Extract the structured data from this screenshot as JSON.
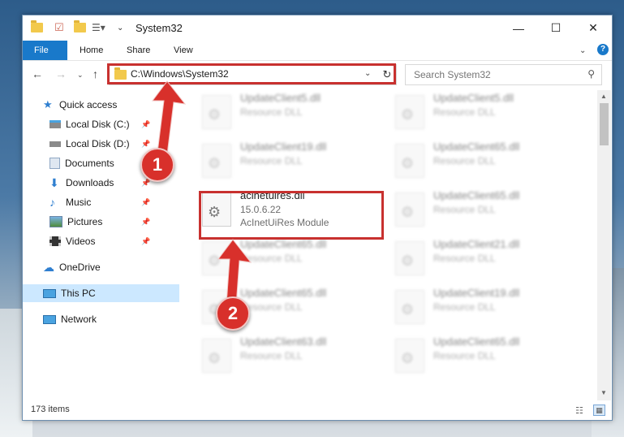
{
  "window": {
    "title": "System32",
    "controls": {
      "minimize": "—",
      "maximize": "☐",
      "close": "✕"
    }
  },
  "ribbon": {
    "tabs": [
      "File",
      "Home",
      "Share",
      "View"
    ],
    "help": "?"
  },
  "navigation": {
    "path": "C:\\Windows\\System32",
    "search_placeholder": "Search System32"
  },
  "sidebar": {
    "items": [
      {
        "label": "Quick access",
        "icon": "star-icon",
        "pinned": false
      },
      {
        "label": "Local Disk (C:)",
        "icon": "drive-icon",
        "pinned": true
      },
      {
        "label": "Local Disk (D:)",
        "icon": "drive-icon",
        "pinned": true
      },
      {
        "label": "Documents",
        "icon": "documents-icon",
        "pinned": true
      },
      {
        "label": "Downloads",
        "icon": "download-icon",
        "pinned": true
      },
      {
        "label": "Music",
        "icon": "music-icon",
        "pinned": true
      },
      {
        "label": "Pictures",
        "icon": "pictures-icon",
        "pinned": true
      },
      {
        "label": "Videos",
        "icon": "videos-icon",
        "pinned": true
      },
      {
        "label": "OneDrive",
        "icon": "cloud-icon",
        "pinned": false
      },
      {
        "label": "This PC",
        "icon": "pc-icon",
        "pinned": false
      },
      {
        "label": "Network",
        "icon": "network-icon",
        "pinned": false
      }
    ]
  },
  "files": {
    "left": [
      {
        "name": "UpdateClient5.dll",
        "line2": "Resource DLL",
        "line3": ""
      },
      {
        "name": "UpdateClient19.dll",
        "line2": "Resource DLL",
        "line3": ""
      },
      {
        "name": "acinetuires.dll",
        "line2": "15.0.6.22",
        "line3": "AcInetUiRes Module"
      },
      {
        "name": "UpdateClient65.dll",
        "line2": "Resource DLL",
        "line3": ""
      },
      {
        "name": "UpdateClient65.dll",
        "line2": "Resource DLL",
        "line3": ""
      },
      {
        "name": "UpdateClient63.dll",
        "line2": "Resource DLL",
        "line3": ""
      }
    ],
    "right": [
      {
        "name": "UpdateClient5.dll",
        "line2": "Resource DLL"
      },
      {
        "name": "UpdateClient65.dll",
        "line2": "Resource DLL"
      },
      {
        "name": "UpdateClient65.dll",
        "line2": "Resource DLL"
      },
      {
        "name": "UpdateClient21.dll",
        "line2": "Resource DLL"
      },
      {
        "name": "UpdateClient19.dll",
        "line2": "Resource DLL"
      },
      {
        "name": "UpdateClient65.dll",
        "line2": "Resource DLL"
      }
    ]
  },
  "status": {
    "item_count": "173 items"
  },
  "annotations": {
    "step1": "1",
    "step2": "2"
  },
  "colors": {
    "highlight": "#c8312f",
    "file_tab": "#1979ca",
    "selection": "#cce8ff"
  }
}
